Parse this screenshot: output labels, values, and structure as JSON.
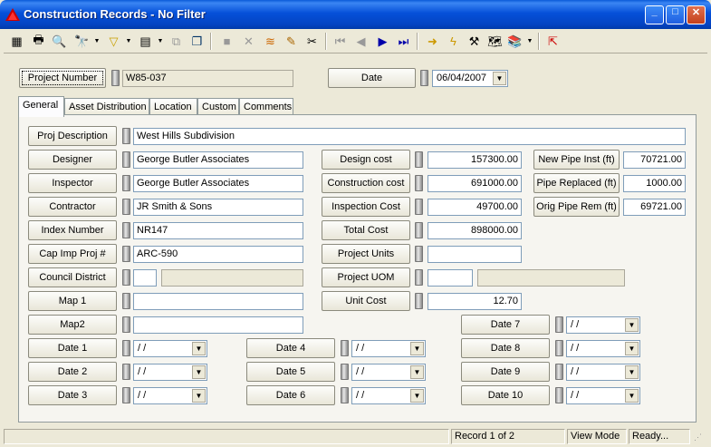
{
  "window": {
    "title": "Construction Records - No Filter",
    "min": "_",
    "max": "□",
    "close": "✕"
  },
  "toolbar": {
    "icons": [
      "grid-icon",
      "print-icon",
      "print-preview-icon",
      "find-icon",
      "filter-icon",
      "form-view-icon",
      "copy-record-icon",
      "delete-record-icon",
      "cancel-icon",
      "stack-icon",
      "edit-pencil-icon",
      "cut-icon",
      "first-record-icon",
      "prev-record-icon",
      "next-record-icon",
      "last-record-icon",
      "goto-arrow-icon",
      "lightning-icon",
      "tools-icon",
      "map-icon",
      "books-icon",
      "export-icon"
    ]
  },
  "header": {
    "project_number_label": "Project Number",
    "project_number_value": "W85-037",
    "date_label": "Date",
    "date_value": "06/04/2007"
  },
  "tabs": [
    "General",
    "Asset Distribution",
    "Location",
    "Custom",
    "Comments"
  ],
  "general": {
    "proj_description_label": "Proj Description",
    "proj_description": "West Hills Subdivision",
    "designer_label": "Designer",
    "designer": "George Butler Associates",
    "inspector_label": "Inspector",
    "inspector": "George Butler Associates",
    "contractor_label": "Contractor",
    "contractor": "JR Smith & Sons",
    "index_number_label": "Index Number",
    "index_number": "NR147",
    "cap_imp_label": "Cap Imp Proj #",
    "cap_imp": "ARC-590",
    "council_district_label": "Council District",
    "council_district": "",
    "map1_label": "Map 1",
    "map1": "",
    "map2_label": "Map2",
    "map2": "",
    "design_cost_label": "Design cost",
    "design_cost": "157300.00",
    "construction_cost_label": "Construction cost",
    "construction_cost": "691000.00",
    "inspection_cost_label": "Inspection Cost",
    "inspection_cost": "49700.00",
    "total_cost_label": "Total Cost",
    "total_cost": "898000.00",
    "project_units_label": "Project Units",
    "project_units": "",
    "project_uom_label": "Project UOM",
    "project_uom": "",
    "unit_cost_label": "Unit Cost",
    "unit_cost": "12.70",
    "new_pipe_label": "New Pipe Inst (ft)",
    "new_pipe": "70721.00",
    "pipe_replaced_label": "Pipe Replaced (ft)",
    "pipe_replaced": "1000.00",
    "orig_pipe_label": "Orig Pipe Rem (ft)",
    "orig_pipe": "69721.00",
    "dates": [
      {
        "label": "Date 1",
        "value": " / /"
      },
      {
        "label": "Date 2",
        "value": " / /"
      },
      {
        "label": "Date 3",
        "value": " / /"
      },
      {
        "label": "Date 4",
        "value": " / /"
      },
      {
        "label": "Date 5",
        "value": " / /"
      },
      {
        "label": "Date 6",
        "value": " / /"
      },
      {
        "label": "Date 7",
        "value": " / /"
      },
      {
        "label": "Date 8",
        "value": " / /"
      },
      {
        "label": "Date 9",
        "value": " / /"
      },
      {
        "label": "Date 10",
        "value": " / /"
      }
    ]
  },
  "status": {
    "pane1": "",
    "record": "Record 1 of 2",
    "mode": "View Mode",
    "state": "Ready..."
  }
}
